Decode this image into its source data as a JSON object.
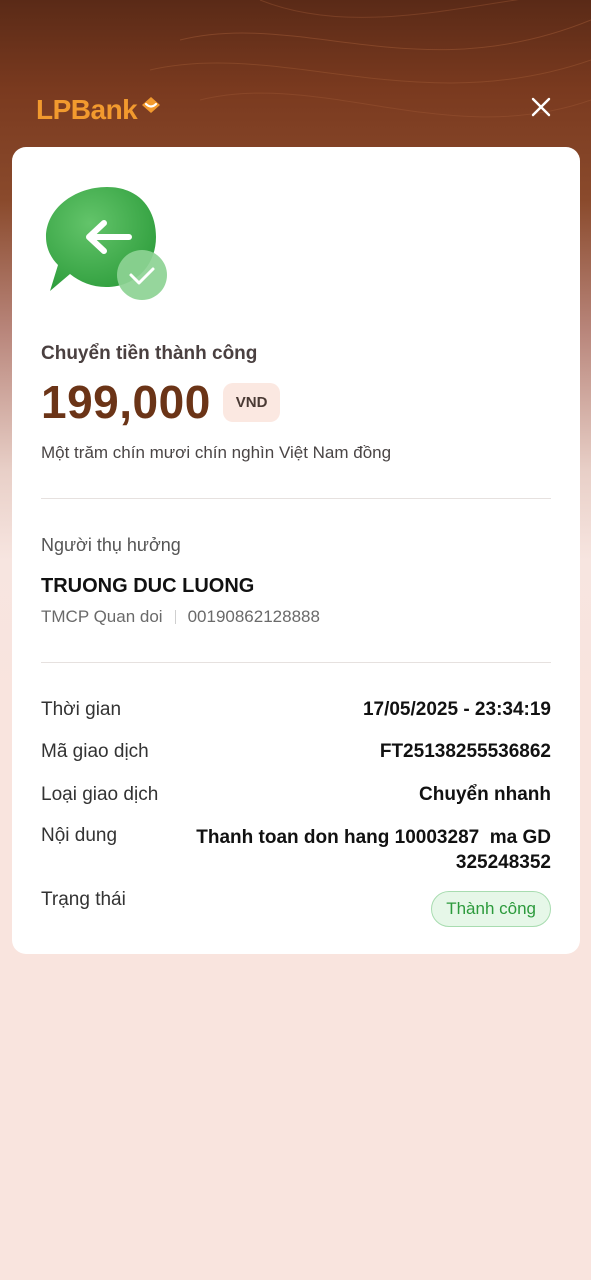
{
  "header": {
    "brand_name": "LPBank",
    "logo_icon": "lpbank-logo-mark",
    "close_icon": "close-icon",
    "brand_color": "#f29a2e"
  },
  "receipt": {
    "title": "Chuyển tiền thành công",
    "amount": "199,000",
    "currency": "VND",
    "amount_in_words": "Một trăm chín mươi chín nghìn Việt Nam đồng",
    "status_icon": "transfer-success-icon"
  },
  "beneficiary": {
    "label": "Người thụ hưởng",
    "name": "TRUONG DUC LUONG",
    "bank": "TMCP Quan doi",
    "account_number": "00190862128888"
  },
  "details": {
    "time_label": "Thời gian",
    "time_value": "17/05/2025 - 23:34:19",
    "transaction_id_label": "Mã giao dịch",
    "transaction_id_value": "FT25138255536862",
    "type_label": "Loại giao dịch",
    "type_value": "Chuyển nhanh",
    "content_label": "Nội dung",
    "content_value": "Thanh toan don hang 10003287  ma GD 325248352",
    "status_label": "Trạng thái",
    "status_value": "Thành công",
    "status_color": "#2c9a3c"
  }
}
